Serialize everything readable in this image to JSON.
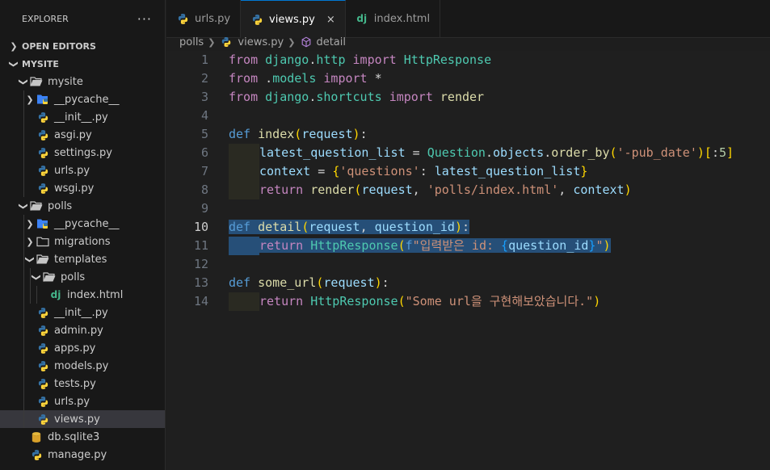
{
  "explorer": {
    "title": "EXPLORER",
    "more": "···",
    "open_editors": "OPEN EDITORS",
    "project": "MYSITE",
    "tree": [
      {
        "label": "mysite",
        "kind": "folder",
        "depth": 1,
        "open": true
      },
      {
        "label": "__pycache__",
        "kind": "pyfolder",
        "depth": 2,
        "open": false
      },
      {
        "label": "__init__.py",
        "kind": "py",
        "depth": 2
      },
      {
        "label": "asgi.py",
        "kind": "py",
        "depth": 2
      },
      {
        "label": "settings.py",
        "kind": "py",
        "depth": 2
      },
      {
        "label": "urls.py",
        "kind": "py",
        "depth": 2
      },
      {
        "label": "wsgi.py",
        "kind": "py",
        "depth": 2
      },
      {
        "label": "polls",
        "kind": "folder",
        "depth": 1,
        "open": true
      },
      {
        "label": "__pycache__",
        "kind": "pyfolder",
        "depth": 2,
        "open": false
      },
      {
        "label": "migrations",
        "kind": "folder",
        "depth": 2,
        "open": false
      },
      {
        "label": "templates",
        "kind": "folder",
        "depth": 2,
        "open": true
      },
      {
        "label": "polls",
        "kind": "folder",
        "depth": 3,
        "open": true
      },
      {
        "label": "index.html",
        "kind": "django",
        "depth": 4
      },
      {
        "label": "__init__.py",
        "kind": "py",
        "depth": 2
      },
      {
        "label": "admin.py",
        "kind": "py",
        "depth": 2
      },
      {
        "label": "apps.py",
        "kind": "py",
        "depth": 2
      },
      {
        "label": "models.py",
        "kind": "py",
        "depth": 2
      },
      {
        "label": "tests.py",
        "kind": "py",
        "depth": 2
      },
      {
        "label": "urls.py",
        "kind": "py",
        "depth": 2
      },
      {
        "label": "views.py",
        "kind": "py",
        "depth": 2,
        "selected": true
      },
      {
        "label": "db.sqlite3",
        "kind": "db",
        "depth": 1
      },
      {
        "label": "manage.py",
        "kind": "py",
        "depth": 1
      }
    ]
  },
  "tabs": [
    {
      "label": "urls.py",
      "icon": "python-icon",
      "active": false
    },
    {
      "label": "views.py",
      "icon": "python-icon",
      "active": true,
      "close": "×"
    },
    {
      "label": "index.html",
      "icon": "django-icon",
      "active": false
    }
  ],
  "breadcrumb": {
    "folder": "polls",
    "file": "views.py",
    "symbol": "detail"
  },
  "editor": {
    "current_line": 10,
    "lines": [
      {
        "n": "1",
        "tokens": [
          [
            "kw",
            "from"
          ],
          [
            "pun",
            " "
          ],
          [
            "cls",
            "django"
          ],
          [
            "pun",
            "."
          ],
          [
            "cls",
            "http"
          ],
          [
            "pun",
            " "
          ],
          [
            "kw",
            "import"
          ],
          [
            "pun",
            " "
          ],
          [
            "cls",
            "HttpResponse"
          ]
        ]
      },
      {
        "n": "2",
        "tokens": [
          [
            "kw",
            "from"
          ],
          [
            "pun",
            " ."
          ],
          [
            "cls",
            "models"
          ],
          [
            "pun",
            " "
          ],
          [
            "kw",
            "import"
          ],
          [
            "pun",
            " *"
          ]
        ]
      },
      {
        "n": "3",
        "tokens": [
          [
            "kw",
            "from"
          ],
          [
            "pun",
            " "
          ],
          [
            "cls",
            "django"
          ],
          [
            "pun",
            "."
          ],
          [
            "cls",
            "shortcuts"
          ],
          [
            "pun",
            " "
          ],
          [
            "kw",
            "import"
          ],
          [
            "pun",
            " "
          ],
          [
            "fn",
            "render"
          ]
        ]
      },
      {
        "n": "4",
        "tokens": []
      },
      {
        "n": "5",
        "tokens": [
          [
            "kd",
            "def"
          ],
          [
            "pun",
            " "
          ],
          [
            "fn",
            "index"
          ],
          [
            "br1",
            "("
          ],
          [
            "var",
            "request"
          ],
          [
            "br1",
            ")"
          ],
          [
            "pun",
            ":"
          ]
        ]
      },
      {
        "n": "6",
        "indent": true,
        "tokens": [
          [
            "var",
            "latest_question_list"
          ],
          [
            "pun",
            " = "
          ],
          [
            "cls",
            "Question"
          ],
          [
            "pun",
            "."
          ],
          [
            "var",
            "objects"
          ],
          [
            "pun",
            "."
          ],
          [
            "fn",
            "order_by"
          ],
          [
            "br1",
            "("
          ],
          [
            "str",
            "'-pub_date'"
          ],
          [
            "br1",
            ")"
          ],
          [
            "br1",
            "["
          ],
          [
            "pun",
            ":"
          ],
          [
            "num",
            "5"
          ],
          [
            "br1",
            "]"
          ]
        ]
      },
      {
        "n": "7",
        "indent": true,
        "tokens": [
          [
            "var",
            "context"
          ],
          [
            "pun",
            " = "
          ],
          [
            "br1",
            "{"
          ],
          [
            "str",
            "'questions'"
          ],
          [
            "pun",
            ": "
          ],
          [
            "var",
            "latest_question_list"
          ],
          [
            "br1",
            "}"
          ]
        ]
      },
      {
        "n": "8",
        "indent": true,
        "tokens": [
          [
            "kw",
            "return"
          ],
          [
            "pun",
            " "
          ],
          [
            "fn",
            "render"
          ],
          [
            "br1",
            "("
          ],
          [
            "var",
            "request"
          ],
          [
            "pun",
            ", "
          ],
          [
            "str",
            "'polls/index.html'"
          ],
          [
            "pun",
            ", "
          ],
          [
            "var",
            "context"
          ],
          [
            "br1",
            ")"
          ]
        ]
      },
      {
        "n": "9",
        "tokens": []
      },
      {
        "n": "10",
        "sel": true,
        "tokens": [
          [
            "kd",
            "def"
          ],
          [
            "pun",
            " "
          ],
          [
            "fn",
            "detail"
          ],
          [
            "br1",
            "("
          ],
          [
            "var",
            "request"
          ],
          [
            "pun",
            ", "
          ],
          [
            "var",
            "question_id"
          ],
          [
            "br1",
            ")"
          ],
          [
            "pun",
            ":"
          ]
        ]
      },
      {
        "n": "11",
        "sel": true,
        "indent": true,
        "tokens": [
          [
            "kw",
            "return"
          ],
          [
            "pun",
            " "
          ],
          [
            "cls",
            "HttpResponse"
          ],
          [
            "br1",
            "("
          ],
          [
            "kd",
            "f"
          ],
          [
            "str",
            "\"입력받은 id: "
          ],
          [
            "br3",
            "{"
          ],
          [
            "var",
            "question_id"
          ],
          [
            "br3",
            "}"
          ],
          [
            "str",
            "\""
          ],
          [
            "br1",
            ")"
          ]
        ]
      },
      {
        "n": "12",
        "tokens": []
      },
      {
        "n": "13",
        "tokens": [
          [
            "kd",
            "def"
          ],
          [
            "pun",
            " "
          ],
          [
            "fn",
            "some_url"
          ],
          [
            "br1",
            "("
          ],
          [
            "var",
            "request"
          ],
          [
            "br1",
            ")"
          ],
          [
            "pun",
            ":"
          ]
        ]
      },
      {
        "n": "14",
        "indent": true,
        "tokens": [
          [
            "kw",
            "return"
          ],
          [
            "pun",
            " "
          ],
          [
            "cls",
            "HttpResponse"
          ],
          [
            "br1",
            "("
          ],
          [
            "str",
            "\"Some url을 구현해보았습니다.\""
          ],
          [
            "br1",
            ")"
          ]
        ]
      }
    ]
  },
  "colors": {
    "selection": "#264f78",
    "accent": "#0078d4",
    "python_blue": "#3572a5",
    "python_yellow": "#ffd43b",
    "django_green": "#44b78b"
  }
}
